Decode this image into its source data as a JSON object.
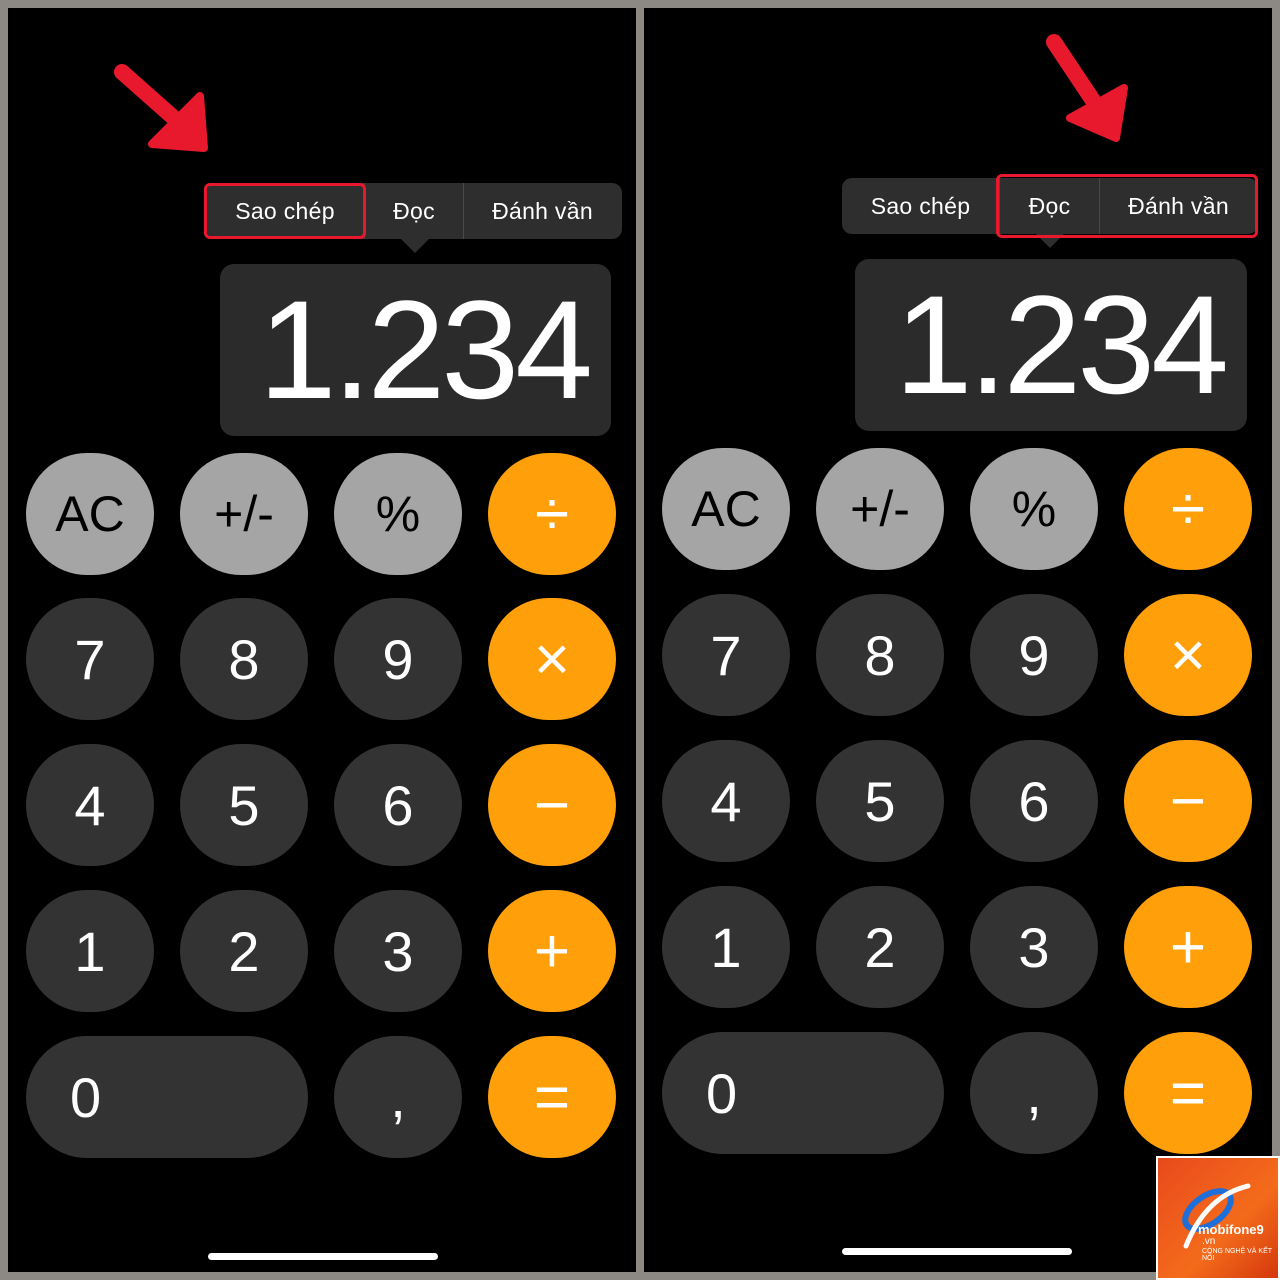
{
  "panels": [
    {
      "menu": {
        "items": [
          "Sao chép",
          "Đọc",
          "Đánh vần"
        ],
        "highlighted": "Sao chép"
      },
      "display": "1.234",
      "keys": {
        "row1": [
          "AC",
          "+/-",
          "%",
          "÷"
        ],
        "row2": [
          "7",
          "8",
          "9",
          "×"
        ],
        "row3": [
          "4",
          "5",
          "6",
          "−"
        ],
        "row4": [
          "1",
          "2",
          "3",
          "+"
        ],
        "row5": [
          "0",
          ",",
          "="
        ]
      }
    },
    {
      "menu": {
        "items": [
          "Sao chép",
          "Đọc",
          "Đánh vần"
        ],
        "highlighted": [
          "Đọc",
          "Đánh vần"
        ]
      },
      "display": "1.234",
      "keys": {
        "row1": [
          "AC",
          "+/-",
          "%",
          "÷"
        ],
        "row2": [
          "7",
          "8",
          "9",
          "×"
        ],
        "row3": [
          "4",
          "5",
          "6",
          "−"
        ],
        "row4": [
          "1",
          "2",
          "3",
          "+"
        ],
        "row5": [
          "0",
          ",",
          "="
        ]
      }
    }
  ],
  "colors": {
    "operator": "#ff9f0a",
    "function": "#a5a5a5",
    "number": "#333333",
    "highlight": "#e8192c"
  },
  "watermark": {
    "icon": "mobifone-logo",
    "brand": "mobifone9",
    "domain": ".vn",
    "tagline": "CÔNG NGHỆ VÀ KẾT NỐI"
  }
}
